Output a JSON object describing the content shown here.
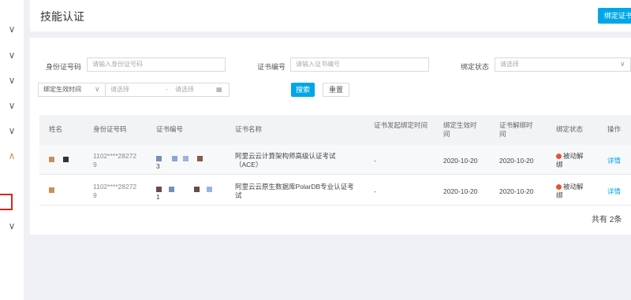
{
  "header": {
    "title": "技能认证",
    "bind_button": "绑定证书"
  },
  "filters": {
    "id_label": "身份证号码",
    "id_placeholder": "请输入身份证号码",
    "cert_label": "证书编号",
    "cert_placeholder": "请输入证书编号",
    "status_label": "绑定状态",
    "status_placeholder": "请选择",
    "time_select": "绑定生效时间",
    "date_start_placeholder": "请选择",
    "date_sep": "-",
    "date_end_placeholder": "请选择",
    "search_label": "搜索",
    "reset_label": "重置"
  },
  "table": {
    "headers": [
      "姓名",
      "身份证号码",
      "证书编号",
      "证书名称",
      "证书发起绑定时间",
      "绑定生效时间",
      "证书解绑时间",
      "绑定状态",
      "操作"
    ],
    "rows": [
      {
        "id": "1102****28272 9",
        "cert": "3",
        "name": "阿里云云计算架构师高级认证考试（ACE）",
        "bind_time": "-",
        "effective": "2020-10-20",
        "unbind": "2020-10-20",
        "status": "被动解绑",
        "action": "详情"
      },
      {
        "id": "1102****28272 9",
        "cert": "1",
        "name": "阿里云云原生数据库PolarDB专业认证考试",
        "bind_time": "-",
        "effective": "2020-10-20",
        "unbind": "2020-10-20",
        "status": "被动解绑",
        "action": "详情"
      }
    ],
    "total": "共有 2条"
  },
  "rail": {
    "icon": "chevron-down-icon",
    "active_icon": "chevron-up-icon",
    "active_color": "#e08a3c"
  },
  "colors": {
    "accent": "#00a7e6",
    "status_dot": "#e8542f"
  }
}
